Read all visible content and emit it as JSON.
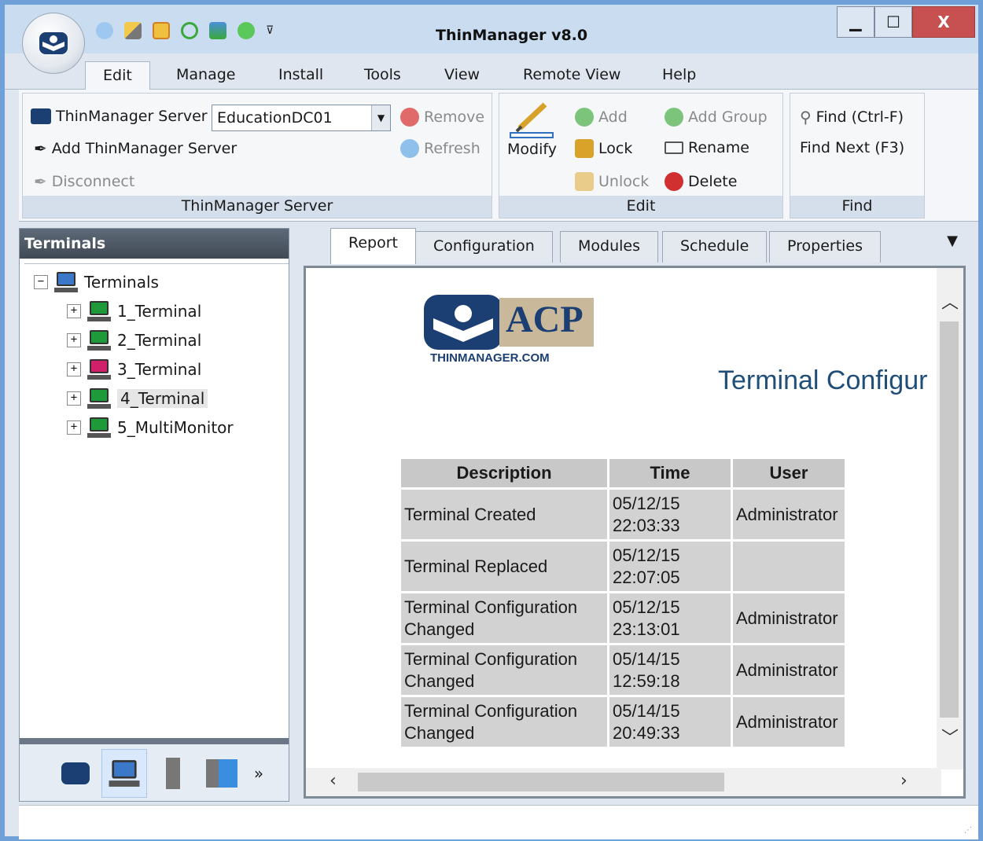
{
  "window": {
    "title": "ThinManager v8.0",
    "minimize": "▁",
    "maximize": "☐",
    "close": "X"
  },
  "qat": {
    "icons": [
      "refresh-icon",
      "edit-icon",
      "message-icon",
      "circle-icon",
      "network-icon",
      "globe-icon"
    ],
    "more": "⊽"
  },
  "ribbon_tabs": [
    "Edit",
    "Manage",
    "Install",
    "Tools",
    "View",
    "Remote View",
    "Help"
  ],
  "ribbon": {
    "server_group": {
      "label": "ThinManager Server",
      "server_label": "ThinManager Server",
      "server_value": "EducationDC01",
      "add_server": "Add ThinManager Server",
      "disconnect": "Disconnect",
      "remove": "Remove",
      "refresh": "Refresh"
    },
    "edit_group": {
      "label": "Edit",
      "modify": "Modify",
      "add": "Add",
      "lock": "Lock",
      "unlock": "Unlock",
      "add_group": "Add Group",
      "rename": "Rename",
      "delete": "Delete"
    },
    "find_group": {
      "label": "Find",
      "find": "Find (Ctrl-F)",
      "find_next": "Find Next (F3)"
    }
  },
  "left_panel": {
    "header": "Terminals",
    "root": "Terminals",
    "items": [
      {
        "label": "1_Terminal",
        "color": "#1f9a3a"
      },
      {
        "label": "2_Terminal",
        "color": "#1f9a3a"
      },
      {
        "label": "3_Terminal",
        "color": "#d0206a"
      },
      {
        "label": "4_Terminal",
        "color": "#1f9a3a"
      },
      {
        "label": "5_MultiMonitor",
        "color": "#1f9a3a"
      }
    ],
    "more": "»"
  },
  "content_tabs": [
    "Report",
    "Configuration",
    "Modules",
    "Schedule",
    "Properties"
  ],
  "report": {
    "logo_text": "ACP",
    "logo_sub": "THINMANAGER.COM",
    "title": "Terminal Configur",
    "headers": {
      "description": "Description",
      "time": "Time",
      "user": "User"
    },
    "rows": [
      {
        "desc1": "Terminal Created",
        "desc2": "",
        "date": "05/12/15",
        "time": "22:03:33",
        "user": "Administrator"
      },
      {
        "desc1": "Terminal Replaced",
        "desc2": "",
        "date": "05/12/15",
        "time": "22:07:05",
        "user": ""
      },
      {
        "desc1": "Terminal Configuration",
        "desc2": "Changed",
        "date": "05/12/15",
        "time": "23:13:01",
        "user": "Administrator"
      },
      {
        "desc1": "Terminal Configuration",
        "desc2": "Changed",
        "date": "05/14/15",
        "time": "12:59:18",
        "user": "Administrator"
      },
      {
        "desc1": "Terminal Configuration",
        "desc2": "Changed",
        "date": "05/14/15",
        "time": "20:49:33",
        "user": "Administrator"
      }
    ]
  },
  "colors": {
    "accent": "#6fa0d8",
    "title_blue": "#1f4e79"
  }
}
